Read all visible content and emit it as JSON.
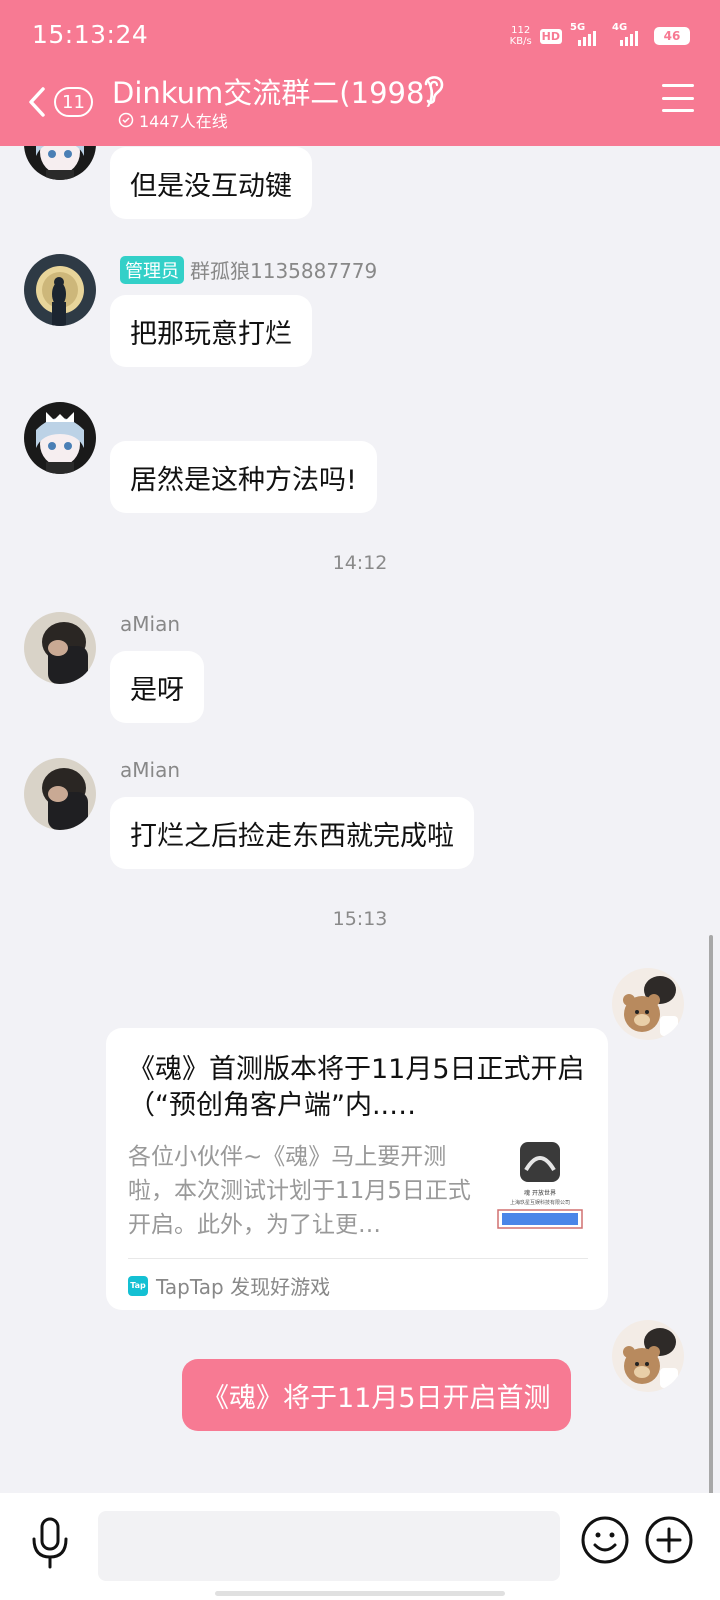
{
  "status_bar": {
    "time": "15:13:24",
    "net_speed_value": "112",
    "net_speed_unit": "KB/s",
    "hd_label": "HD",
    "sim1_label": "5G",
    "sim2_label": "4G",
    "battery": "46"
  },
  "header": {
    "unread_count": "11",
    "title": "Dinkum交流群二(1998)",
    "online_text": "1447人在线",
    "background_color": "#f77a93"
  },
  "messages": [
    {
      "text": "但是没互动键"
    },
    {
      "admin_badge": "管理员",
      "sender": "群孤狼1135887779",
      "text": "把那玩意打烂"
    },
    {
      "text": "居然是这种方法吗!"
    },
    {
      "sender": "aMian",
      "text": "是呀"
    },
    {
      "sender": "aMian",
      "text": "打烂之后捡走东西就完成啦"
    }
  ],
  "timestamps": [
    "14:12",
    "15:13"
  ],
  "shared_card": {
    "title": "《魂》首测版本将于11月5日正式开启（“预创角客户端”内..…",
    "description": "各位小伙伴~《魂》马上要开测啦，本次测试计划于11月5日正式开启。此外，为了让更…",
    "thumb_caption": "魂 开放世界",
    "thumb_company": "上海玖星互娱科技有限公司",
    "source_logo": "Tap",
    "source": "TapTap 发现好游戏"
  },
  "my_message": "《魂》将于11月5日开启首测",
  "accent_color": "#f77a93",
  "admin_color": "#33d0c8"
}
